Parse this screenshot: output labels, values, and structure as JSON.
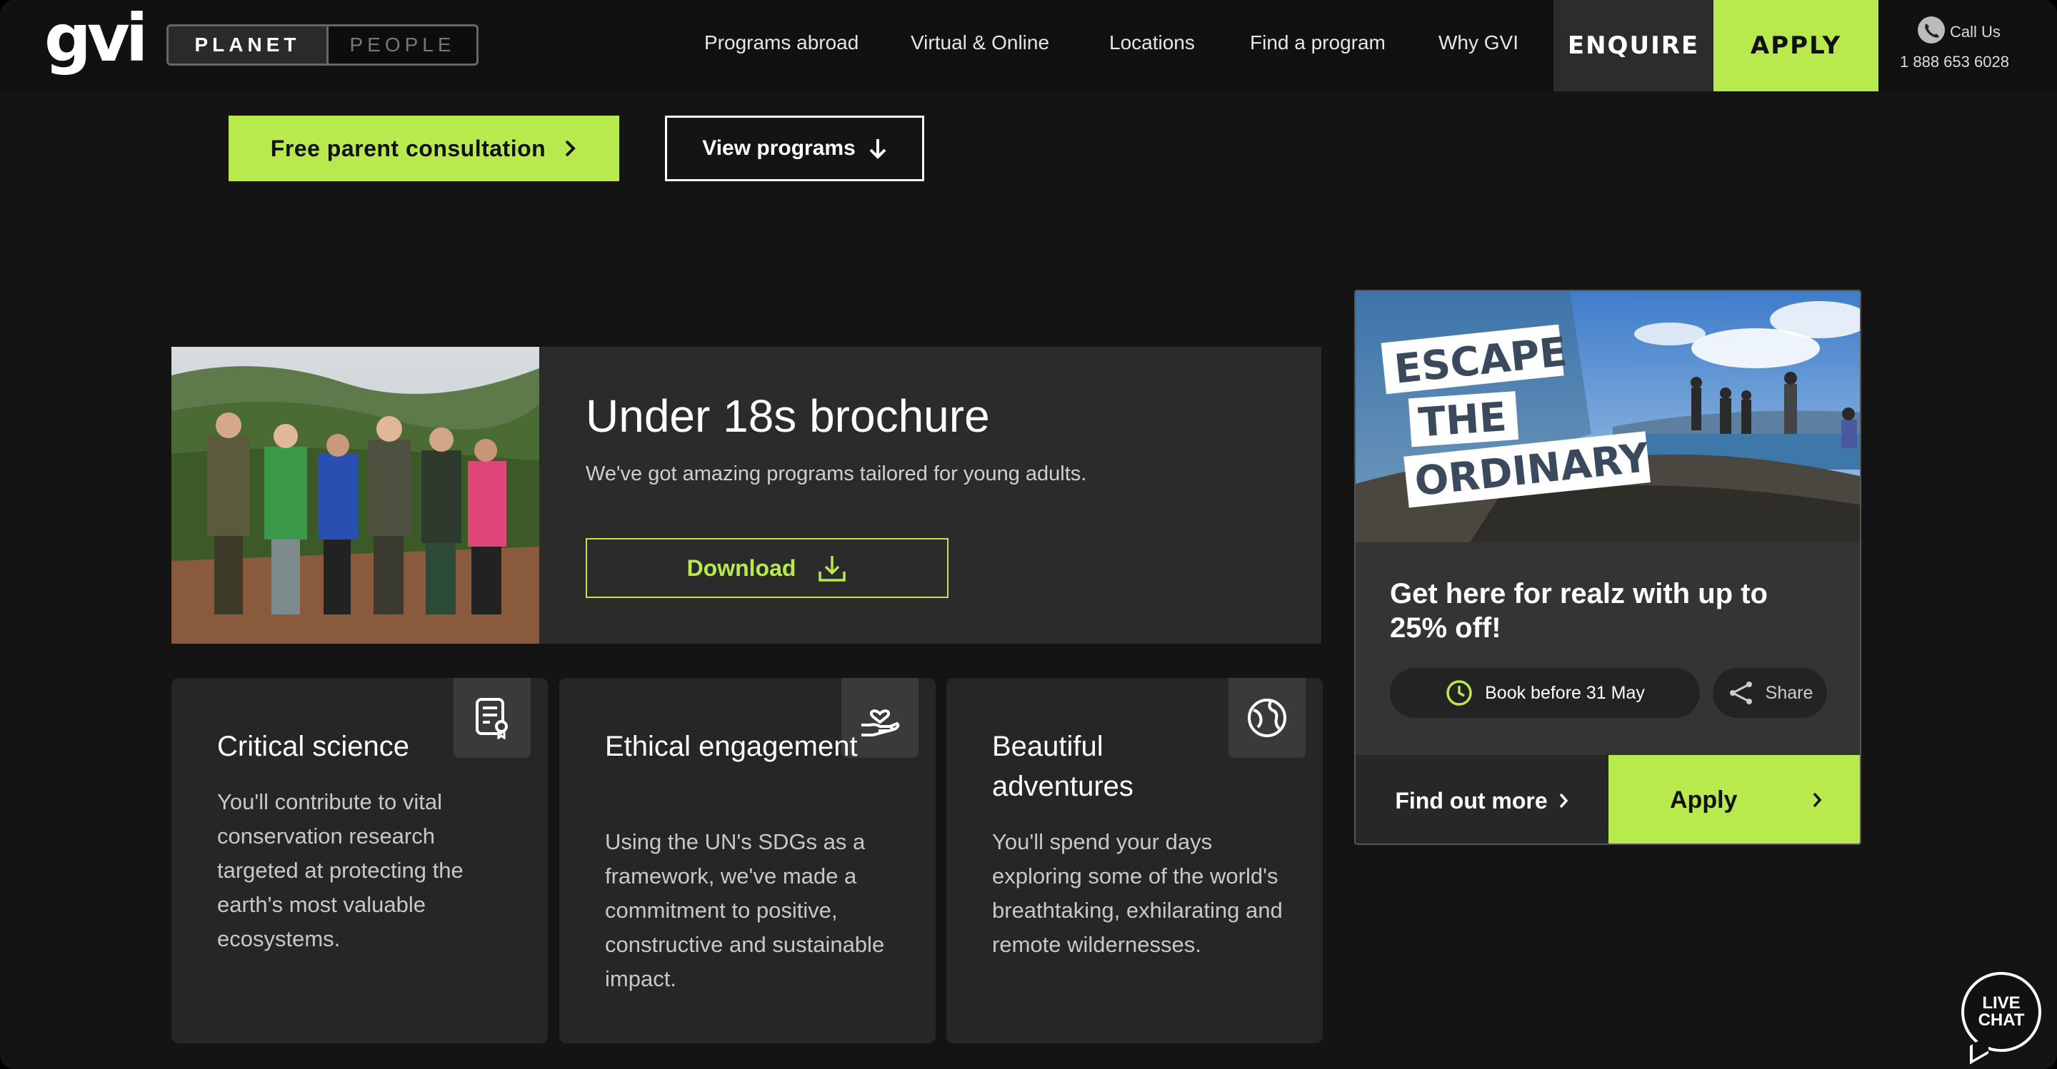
{
  "header": {
    "logo": "gvi",
    "toggle": {
      "active": "PLANET",
      "inactive": "PEOPLE"
    },
    "nav": [
      "Programs abroad",
      "Virtual & Online",
      "Locations",
      "Find a program",
      "Why GVI"
    ],
    "enquire_label": "ENQUIRE",
    "apply_label": "APPLY",
    "call_label": "Call Us",
    "phone": "1 888 653 6028"
  },
  "hero": {
    "consult_label": "Free parent consultation",
    "programs_label": "View programs"
  },
  "brochure": {
    "title": "Under 18s brochure",
    "subtitle": "We've got amazing programs tailored for young adults.",
    "download_label": "Download"
  },
  "cards": [
    {
      "title": "Critical science",
      "body": "You'll contribute to vital conservation research targeted at protecting the earth's most valuable ecosystems.",
      "icon": "certificate-icon"
    },
    {
      "title": "Ethical engagement",
      "body": "Using the UN's SDGs as a framework, we've made a commitment to positive, constructive and sustainable impact.",
      "icon": "heart-hand-icon"
    },
    {
      "title": "Beautiful adventures",
      "body": "You'll spend your days exploring some of the world's breathtaking, exhilarating and remote wildernesses.",
      "icon": "globe-icon"
    }
  ],
  "promo": {
    "image_text": [
      "ESCAPE",
      "THE",
      "ORDINARY"
    ],
    "heading": "Get here for realz with up to 25% off!",
    "book_label": "Book before 31 May",
    "share_label": "Share",
    "find_more_label": "Find out more",
    "apply_label": "Apply"
  },
  "live_chat": {
    "line1": "LIVE",
    "line2": "CHAT"
  },
  "colors": {
    "accent": "#b8ea4e",
    "background": "#141414",
    "panel": "#2b2b2b"
  }
}
